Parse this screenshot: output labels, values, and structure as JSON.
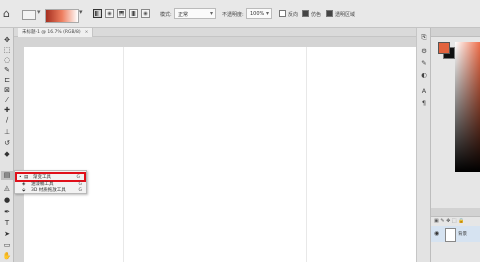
{
  "options_bar": {
    "home_icon": "home-icon",
    "gradient_colors": [
      "#a52f20",
      "#ee7f60",
      "#ffffff"
    ],
    "gradient_types": [
      "linear",
      "radial",
      "angle",
      "reflected",
      "diamond"
    ],
    "mode_label": "模式:",
    "mode_value": "正常",
    "opacity_label": "不透明度:",
    "opacity_value": "100%",
    "reverse_label": "反向",
    "dither_label": "仿色",
    "transparency_label": "透明区域"
  },
  "document_tab": {
    "title": "未标题-1 @ 16.7% (RGB/8)",
    "close": "×"
  },
  "toolbar": {
    "icons": [
      "move-icon",
      "marquee-icon",
      "lasso-icon",
      "quick-select-icon",
      "crop-icon",
      "frame-icon",
      "eyedropper-icon",
      "healing-icon",
      "brush-icon",
      "stamp-icon",
      "history-brush-icon",
      "eraser-icon",
      "gradient-icon",
      "blur-icon",
      "dodge-icon",
      "pen-icon",
      "type-icon",
      "path-select-icon",
      "rectangle-icon",
      "hand-icon"
    ]
  },
  "tool_flyout": {
    "items": [
      {
        "label": "渐变工具",
        "shortcut": "G",
        "active": true
      },
      {
        "label": "油漆桶工具",
        "shortcut": "G",
        "active": false
      },
      {
        "label": "3D 材质拖放工具",
        "shortcut": "G",
        "active": false
      }
    ]
  },
  "layers": {
    "layer_name": "背景"
  },
  "colors": {
    "foreground": "#e2633e",
    "background": "#111111",
    "highlight": "#e0101a"
  }
}
